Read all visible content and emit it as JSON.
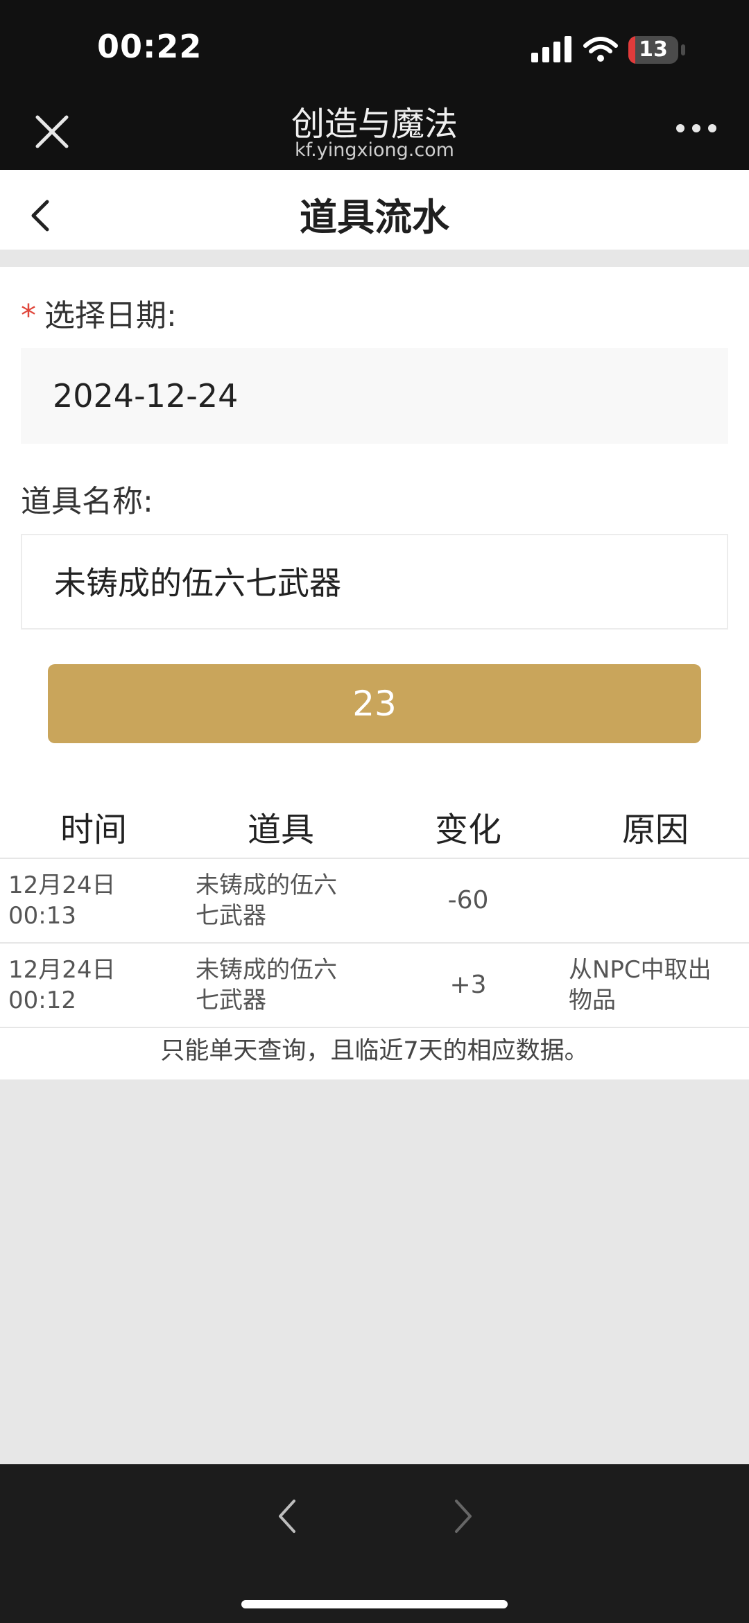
{
  "status_bar": {
    "time": "00:22",
    "battery_level": "13",
    "icons": [
      "signal-icon",
      "wifi-icon",
      "battery-icon"
    ]
  },
  "title_bar": {
    "app_name": "创造与魔法",
    "domain": "kf.yingxiong.com",
    "icons": [
      "close-icon",
      "more-icon"
    ]
  },
  "page": {
    "title": "道具流水",
    "back_icon": "chevron-left-icon"
  },
  "form": {
    "date_label": "选择日期:",
    "required_mark": "*",
    "date_value": "2024-12-24",
    "item_label": "道具名称:",
    "item_value": "未铸成的伍六七武器",
    "submit_label": "23",
    "accent_color": "#c9a55b"
  },
  "table": {
    "headers": [
      "时间",
      "道具",
      "变化",
      "原因"
    ],
    "rows": [
      {
        "time_line1": "12月24日",
        "time_line2": "00:13",
        "item_line1": "未铸成的伍六",
        "item_line2": "七武器",
        "change": "-60",
        "reason_line1": "",
        "reason_line2": ""
      },
      {
        "time_line1": "12月24日",
        "time_line2": "00:12",
        "item_line1": "未铸成的伍六",
        "item_line2": "七武器",
        "change": "+3",
        "reason_line1": "从NPC中取出",
        "reason_line2": "物品"
      }
    ],
    "footnote": "只能单天查询，且临近7天的相应数据。"
  },
  "bottom_nav": {
    "icons": [
      "chevron-left-icon",
      "chevron-right-icon"
    ]
  }
}
